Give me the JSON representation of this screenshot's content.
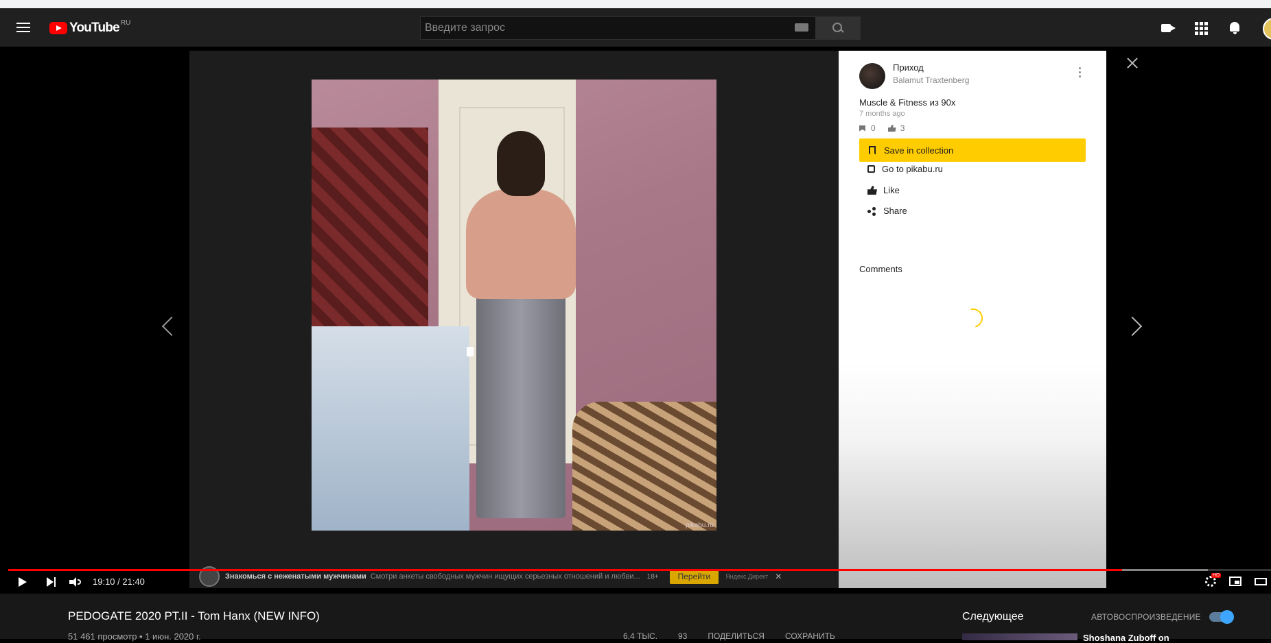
{
  "header": {
    "logo_text": "YouTube",
    "region": "RU",
    "search_placeholder": "Введите запрос"
  },
  "player": {
    "post_card": {
      "channel_name": "Приход",
      "author": "Balamut Traxtenberg",
      "title": "Muscle & Fitness из 90х",
      "time": "7 months ago",
      "comments_count": "0",
      "likes_count": "3",
      "save_label": "Save in collection",
      "goto_label": "Go to pikabu.ru",
      "like_label": "Like",
      "share_label": "Share",
      "comments_label": "Comments"
    },
    "photo_watermark": "pikabu.ru",
    "ad": {
      "title": "Знакомься с неженатыми мужчинами",
      "desc": "Смотри анкеты свободных мужчин ищущих серьезных отношений и любви...",
      "age": "18+",
      "button": "Перейти",
      "source": "Яндекс.Директ",
      "close": "✕"
    },
    "time": "19:10 / 21:40",
    "progress_played": 0.882,
    "progress_buffered": 0.95,
    "hd_badge": "HD"
  },
  "video": {
    "title": "PEDOGATE 2020 PT.II - Tom Hanx (NEW INFO)",
    "meta": "51 461 просмотр • 1 июн. 2020 г.",
    "likes": "6,4 ТЫС.",
    "dislikes": "93",
    "share": "ПОДЕЛИТЬСЯ",
    "save": "СОХРАНИТЬ"
  },
  "sidebar": {
    "next_label": "Следующее",
    "autoplay_label": "АВТОВОСПРОИЗВЕДЕНИЕ",
    "autoplay_on": true,
    "first_rec_title": "Shoshana Zuboff on"
  },
  "colors": {
    "accent": "#ff0000",
    "save_button": "#ffcc00",
    "toggle": "#3ea6ff"
  }
}
